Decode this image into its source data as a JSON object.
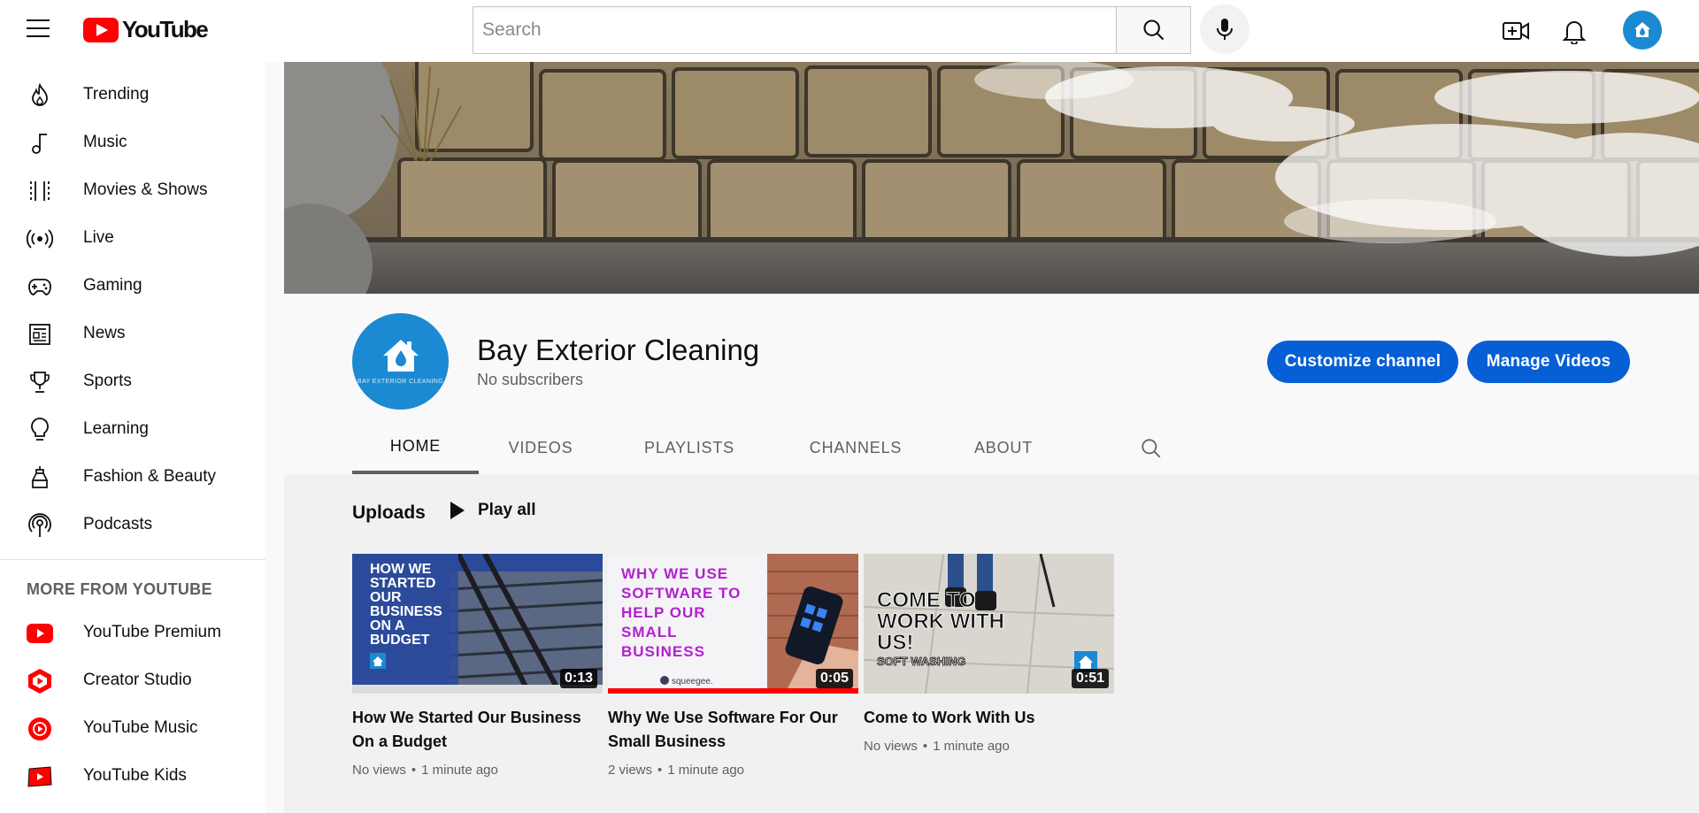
{
  "header": {
    "logo_text": "YouTube",
    "search_placeholder": "Search"
  },
  "sidebar": {
    "items": [
      {
        "label": "Trending",
        "icon": "trending-icon"
      },
      {
        "label": "Music",
        "icon": "music-icon"
      },
      {
        "label": "Movies & Shows",
        "icon": "movies-icon"
      },
      {
        "label": "Live",
        "icon": "live-icon"
      },
      {
        "label": "Gaming",
        "icon": "gaming-icon"
      },
      {
        "label": "News",
        "icon": "news-icon"
      },
      {
        "label": "Sports",
        "icon": "sports-icon"
      },
      {
        "label": "Learning",
        "icon": "learning-icon"
      },
      {
        "label": "Fashion & Beauty",
        "icon": "fashion-icon"
      },
      {
        "label": "Podcasts",
        "icon": "podcasts-icon"
      }
    ],
    "more_heading": "MORE FROM YOUTUBE",
    "more_items": [
      {
        "label": "YouTube Premium",
        "icon": "youtube-premium-icon"
      },
      {
        "label": "Creator Studio",
        "icon": "creator-studio-icon"
      },
      {
        "label": "YouTube Music",
        "icon": "youtube-music-icon"
      },
      {
        "label": "YouTube Kids",
        "icon": "youtube-kids-icon"
      }
    ]
  },
  "channel": {
    "name": "Bay Exterior Cleaning",
    "subscribers": "No subscribers",
    "avatar_caption": "BAY EXTERIOR CLEANING",
    "customize_label": "Customize channel",
    "manage_label": "Manage Videos",
    "tabs": [
      "HOME",
      "VIDEOS",
      "PLAYLISTS",
      "CHANNELS",
      "ABOUT"
    ],
    "active_tab": "HOME"
  },
  "uploads": {
    "title": "Uploads",
    "play_all": "Play all",
    "videos": [
      {
        "title": "How We Started Our Business On a Budget",
        "duration": "0:13",
        "views": "No views",
        "age": "1 minute ago",
        "thumb_text": "HOW WE STARTED OUR BUSINESS ON A BUDGET"
      },
      {
        "title": "Why We Use Software For Our Small Business",
        "duration": "0:05",
        "views": "2 views",
        "age": "1 minute ago",
        "thumb_text": "WHY WE USE SOFTWARE TO HELP OUR SMALL BUSINESS",
        "thumb_brand": "squeegee."
      },
      {
        "title": "Come to Work With Us",
        "duration": "0:51",
        "views": "No views",
        "age": "1 minute ago",
        "thumb_text": "COME TO WORK WITH US!",
        "thumb_subtext": "SOFT WASHING"
      }
    ]
  },
  "colors": {
    "brand_red": "#ff0000",
    "accent_blue": "#065fd4",
    "avatar_blue": "#1b8ad3",
    "thumb_purple": "#b41fd1"
  }
}
